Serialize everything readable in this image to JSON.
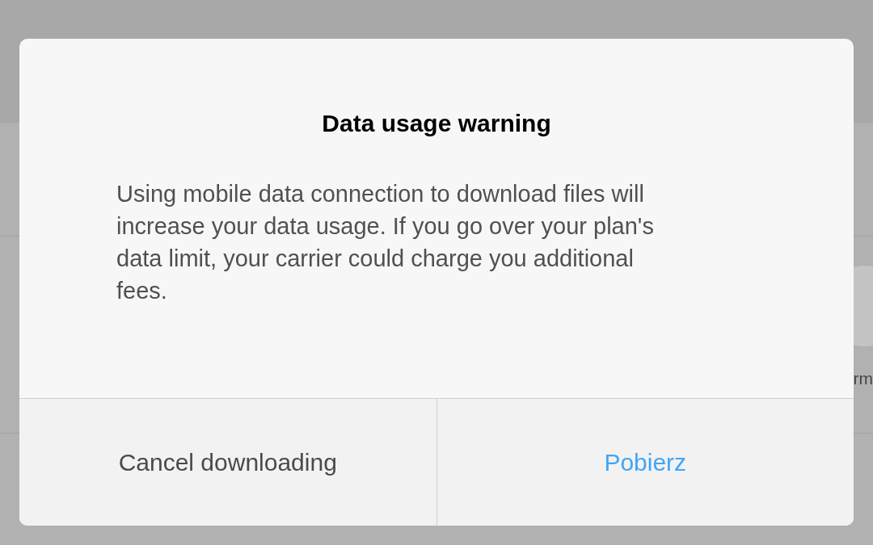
{
  "background": {
    "partial_label": "rm"
  },
  "dialog": {
    "title": "Data usage warning",
    "message": "Using mobile data connection to download files will increase your data usage. If you go over your plan's data limit, your carrier could charge you additional fees.",
    "buttons": [
      {
        "label": "Cancel downloading",
        "kind": "neutral"
      },
      {
        "label": "Pobierz",
        "kind": "primary"
      }
    ]
  }
}
